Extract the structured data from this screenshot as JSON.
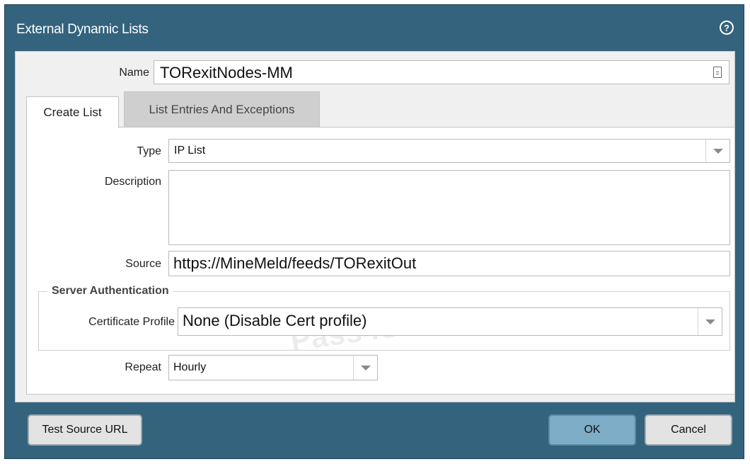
{
  "dialog": {
    "title": "External Dynamic Lists",
    "help_icon": "question-circle-icon",
    "help_glyph": "?"
  },
  "name": {
    "label": "Name",
    "value": "TORexitNodes-MM"
  },
  "tabs": [
    {
      "label": "Create List",
      "active": true
    },
    {
      "label": "List Entries And Exceptions",
      "active": false
    }
  ],
  "form": {
    "type_label": "Type",
    "type_value": "IP List",
    "description_label": "Description",
    "description_value": "",
    "source_label": "Source",
    "source_value": "https://MineMeld/feeds/TORexitOut",
    "server_auth_legend": "Server Authentication",
    "cert_profile_label": "Certificate Profile",
    "cert_profile_value": "None (Disable Cert profile)",
    "repeat_label": "Repeat",
    "repeat_value": "Hourly"
  },
  "buttons": {
    "test_source": "Test Source URL",
    "ok": "OK",
    "cancel": "Cancel"
  },
  "watermark": "Pass4Sure",
  "colors": {
    "header": "#33637d",
    "primary_button": "#7dadc7"
  }
}
